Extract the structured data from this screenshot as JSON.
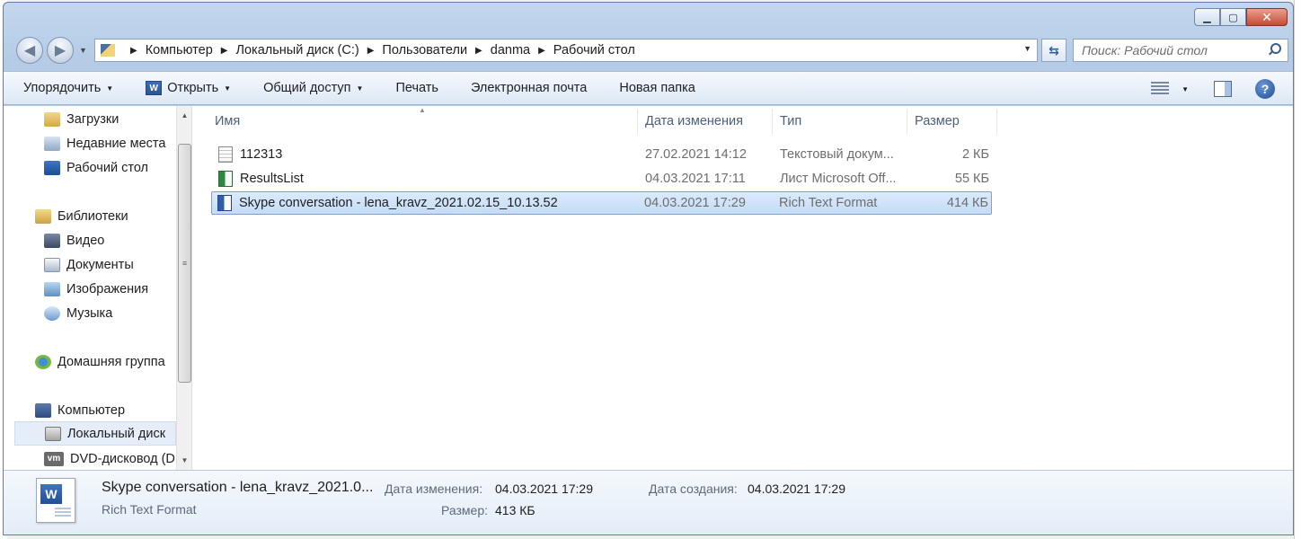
{
  "window": {
    "minimize_glyph": "▁",
    "maximize_glyph": "▢",
    "close_glyph": "✕"
  },
  "address_bar": {
    "crumbs": [
      "Компьютер",
      "Локальный диск (C:)",
      "Пользователи",
      "danma",
      "Рабочий стол"
    ],
    "separator": "▶"
  },
  "search": {
    "placeholder": "Поиск: Рабочий стол"
  },
  "toolbar": {
    "organize": "Упорядочить",
    "open": "Открыть",
    "share": "Общий доступ",
    "print": "Печать",
    "email": "Электронная почта",
    "new_folder": "Новая папка"
  },
  "nav_pane": {
    "items": [
      {
        "label": "Загрузки",
        "icon": "downloads-icon"
      },
      {
        "label": "Недавние места",
        "icon": "recent-places-icon"
      },
      {
        "label": "Рабочий стол",
        "icon": "desktop-icon"
      },
      {
        "label": "Библиотеки",
        "icon": "libraries-icon"
      },
      {
        "label": "Видео",
        "icon": "video-icon"
      },
      {
        "label": "Документы",
        "icon": "documents-icon"
      },
      {
        "label": "Изображения",
        "icon": "images-icon"
      },
      {
        "label": "Музыка",
        "icon": "music-icon"
      },
      {
        "label": "Домашняя группа",
        "icon": "homegroup-icon"
      },
      {
        "label": "Компьютер",
        "icon": "computer-icon"
      },
      {
        "label": "Локальный диск",
        "icon": "local-disk-icon"
      },
      {
        "label": "DVD-дисковод (D",
        "icon": "vm-dvd-icon"
      }
    ],
    "selected": "Локальный диск",
    "vm_badge": "vm"
  },
  "file_list": {
    "columns": [
      "Имя",
      "Дата изменения",
      "Тип",
      "Размер"
    ],
    "rows": [
      {
        "name": "112313",
        "modified": "27.02.2021 14:12",
        "type": "Текстовый докум...",
        "size": "2 КБ",
        "icon": "text-file-icon"
      },
      {
        "name": "ResultsList",
        "modified": "04.03.2021 17:11",
        "type": "Лист Microsoft Off...",
        "size": "55 КБ",
        "icon": "excel-file-icon"
      },
      {
        "name": "Skype conversation - lena_kravz_2021.02.15_10.13.52",
        "modified": "04.03.2021 17:29",
        "type": "Rich Text Format",
        "size": "414 КБ",
        "icon": "word-rtf-file-icon"
      }
    ],
    "selected_row": 2
  },
  "details": {
    "name": "Skype conversation - lena_kravz_2021.0...",
    "type": "Rich Text Format",
    "modified_label": "Дата изменения:",
    "modified_value": "04.03.2021 17:29",
    "created_label": "Дата создания:",
    "created_value": "04.03.2021 17:29",
    "size_label": "Размер:",
    "size_value": "413 КБ"
  },
  "colors": {
    "accent": "#2d5ea9",
    "selection": "#c4dcf7",
    "frame": "#b9cfe8"
  }
}
